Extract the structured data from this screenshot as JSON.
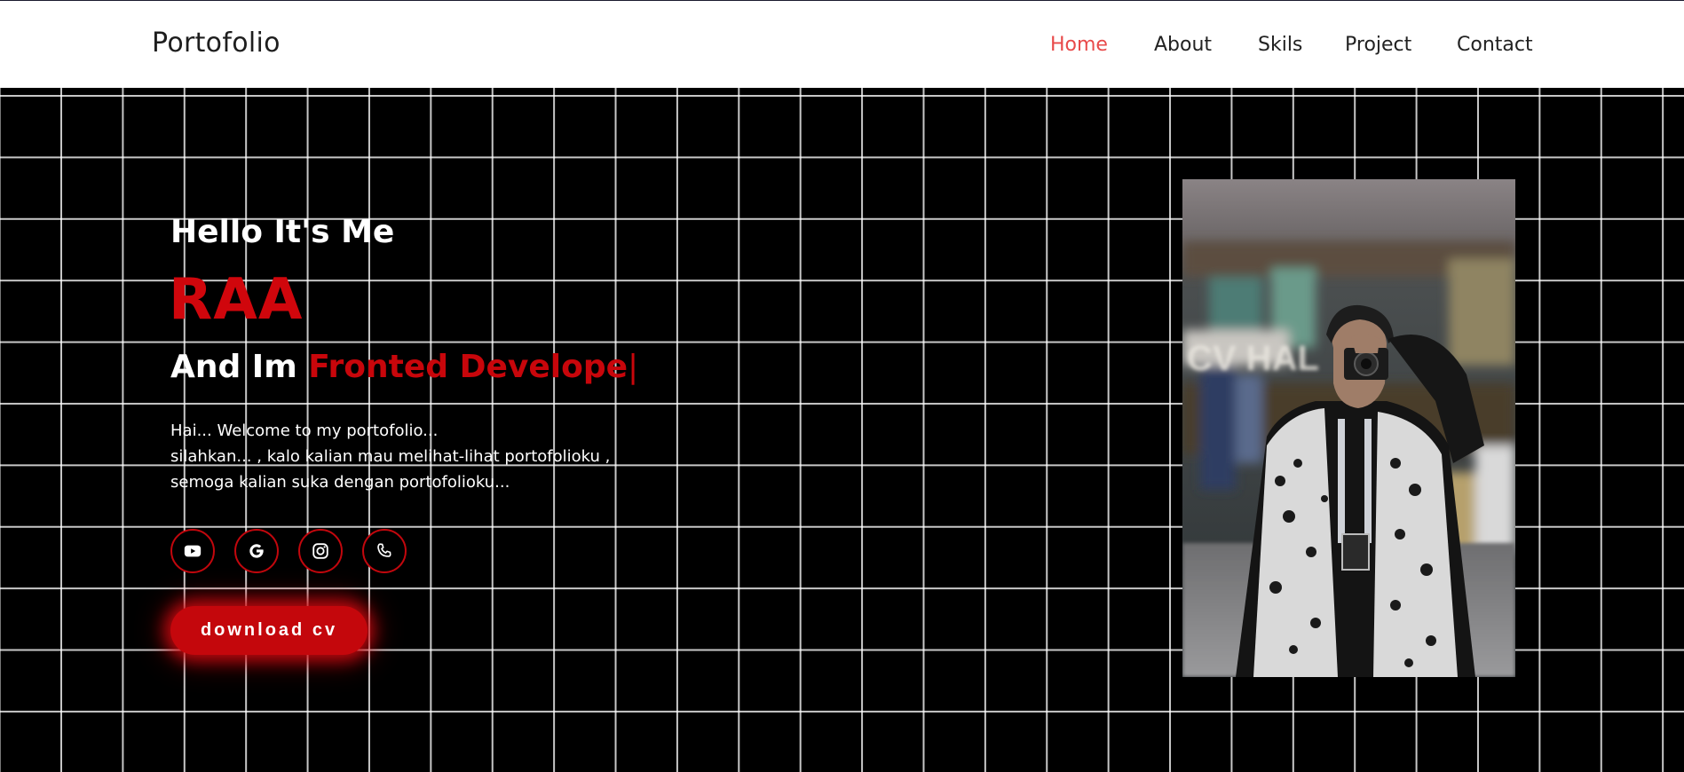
{
  "nav": {
    "logo": "Portofolio",
    "links": [
      {
        "label": "Home",
        "active": true
      },
      {
        "label": "About",
        "active": false
      },
      {
        "label": "Skils",
        "active": false
      },
      {
        "label": "Project",
        "active": false
      },
      {
        "label": "Contact",
        "active": false
      }
    ]
  },
  "hero": {
    "greeting": "Hello It's Me",
    "name": "RAA",
    "role_prefix": "And Im ",
    "role_typed": "Fronted Develope",
    "role_caret": "|",
    "description": [
      "Hai... Welcome to my portofolio...",
      "silahkan... , kalo kalian mau melihat-lihat portofolioku ,",
      "semoga kalian suka dengan portofolioku..."
    ],
    "socials": [
      {
        "icon": "youtube-icon"
      },
      {
        "icon": "google-icon"
      },
      {
        "icon": "instagram-icon"
      },
      {
        "icon": "phone-icon"
      }
    ],
    "cta_label": "download cv"
  },
  "colors": {
    "accent_red": "#d0060c",
    "nav_active": "#e84a4a",
    "background": "#000000",
    "grid": "#ffffff"
  }
}
